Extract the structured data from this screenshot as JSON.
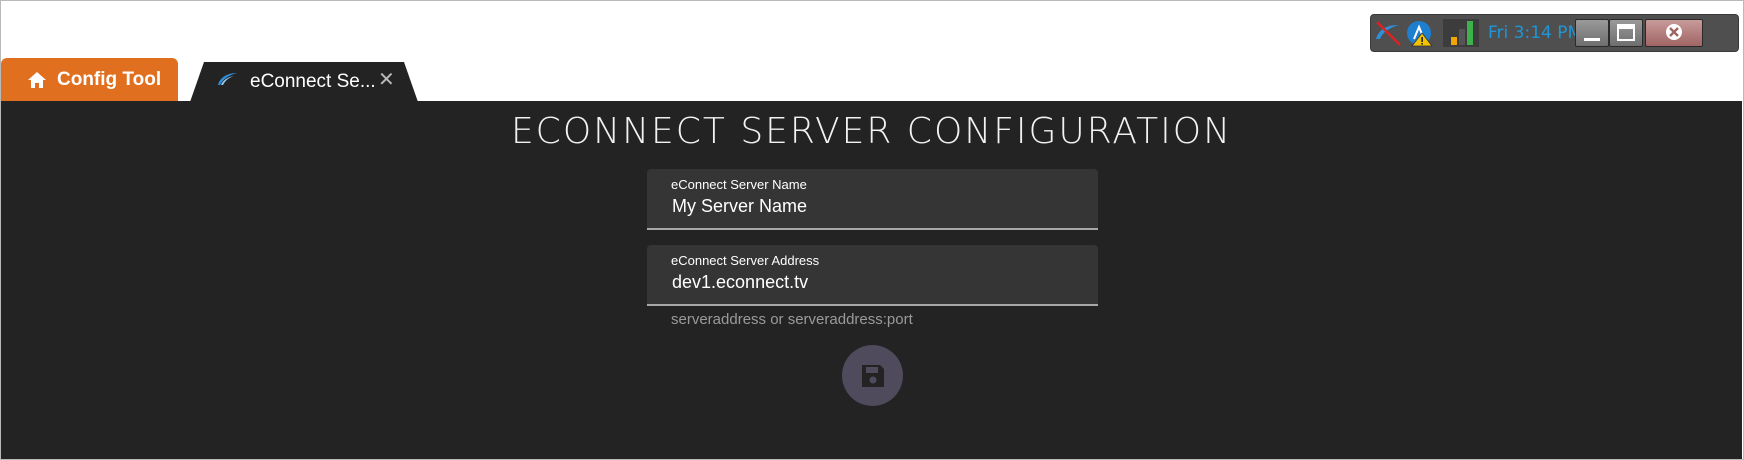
{
  "tabs": {
    "home_label": "Config Tool",
    "active_label": "eConnect Se...",
    "close_glyph": "✕"
  },
  "tray": {
    "time": "Fri 3:14 PM",
    "icons": [
      "network-disabled-icon",
      "warning-status-icon",
      "signal-bars-icon"
    ],
    "window_buttons": [
      "minimize-icon",
      "maximize-icon",
      "close-icon"
    ]
  },
  "page": {
    "title": "ECONNECT SERVER CONFIGURATION",
    "server_name": {
      "label": "eConnect Server Name",
      "value": "My Server Name"
    },
    "server_address": {
      "label": "eConnect Server Address",
      "value": "dev1.econnect.tv",
      "hint": "serveraddress or serveraddress:port"
    },
    "save_icon": "floppy-disk-icon"
  },
  "colors": {
    "accent_tab": "#e06f1f",
    "background": "#232323",
    "field_bg": "#353535",
    "save_button": "#4f4a5c",
    "tray_time": "#1e96d8"
  }
}
